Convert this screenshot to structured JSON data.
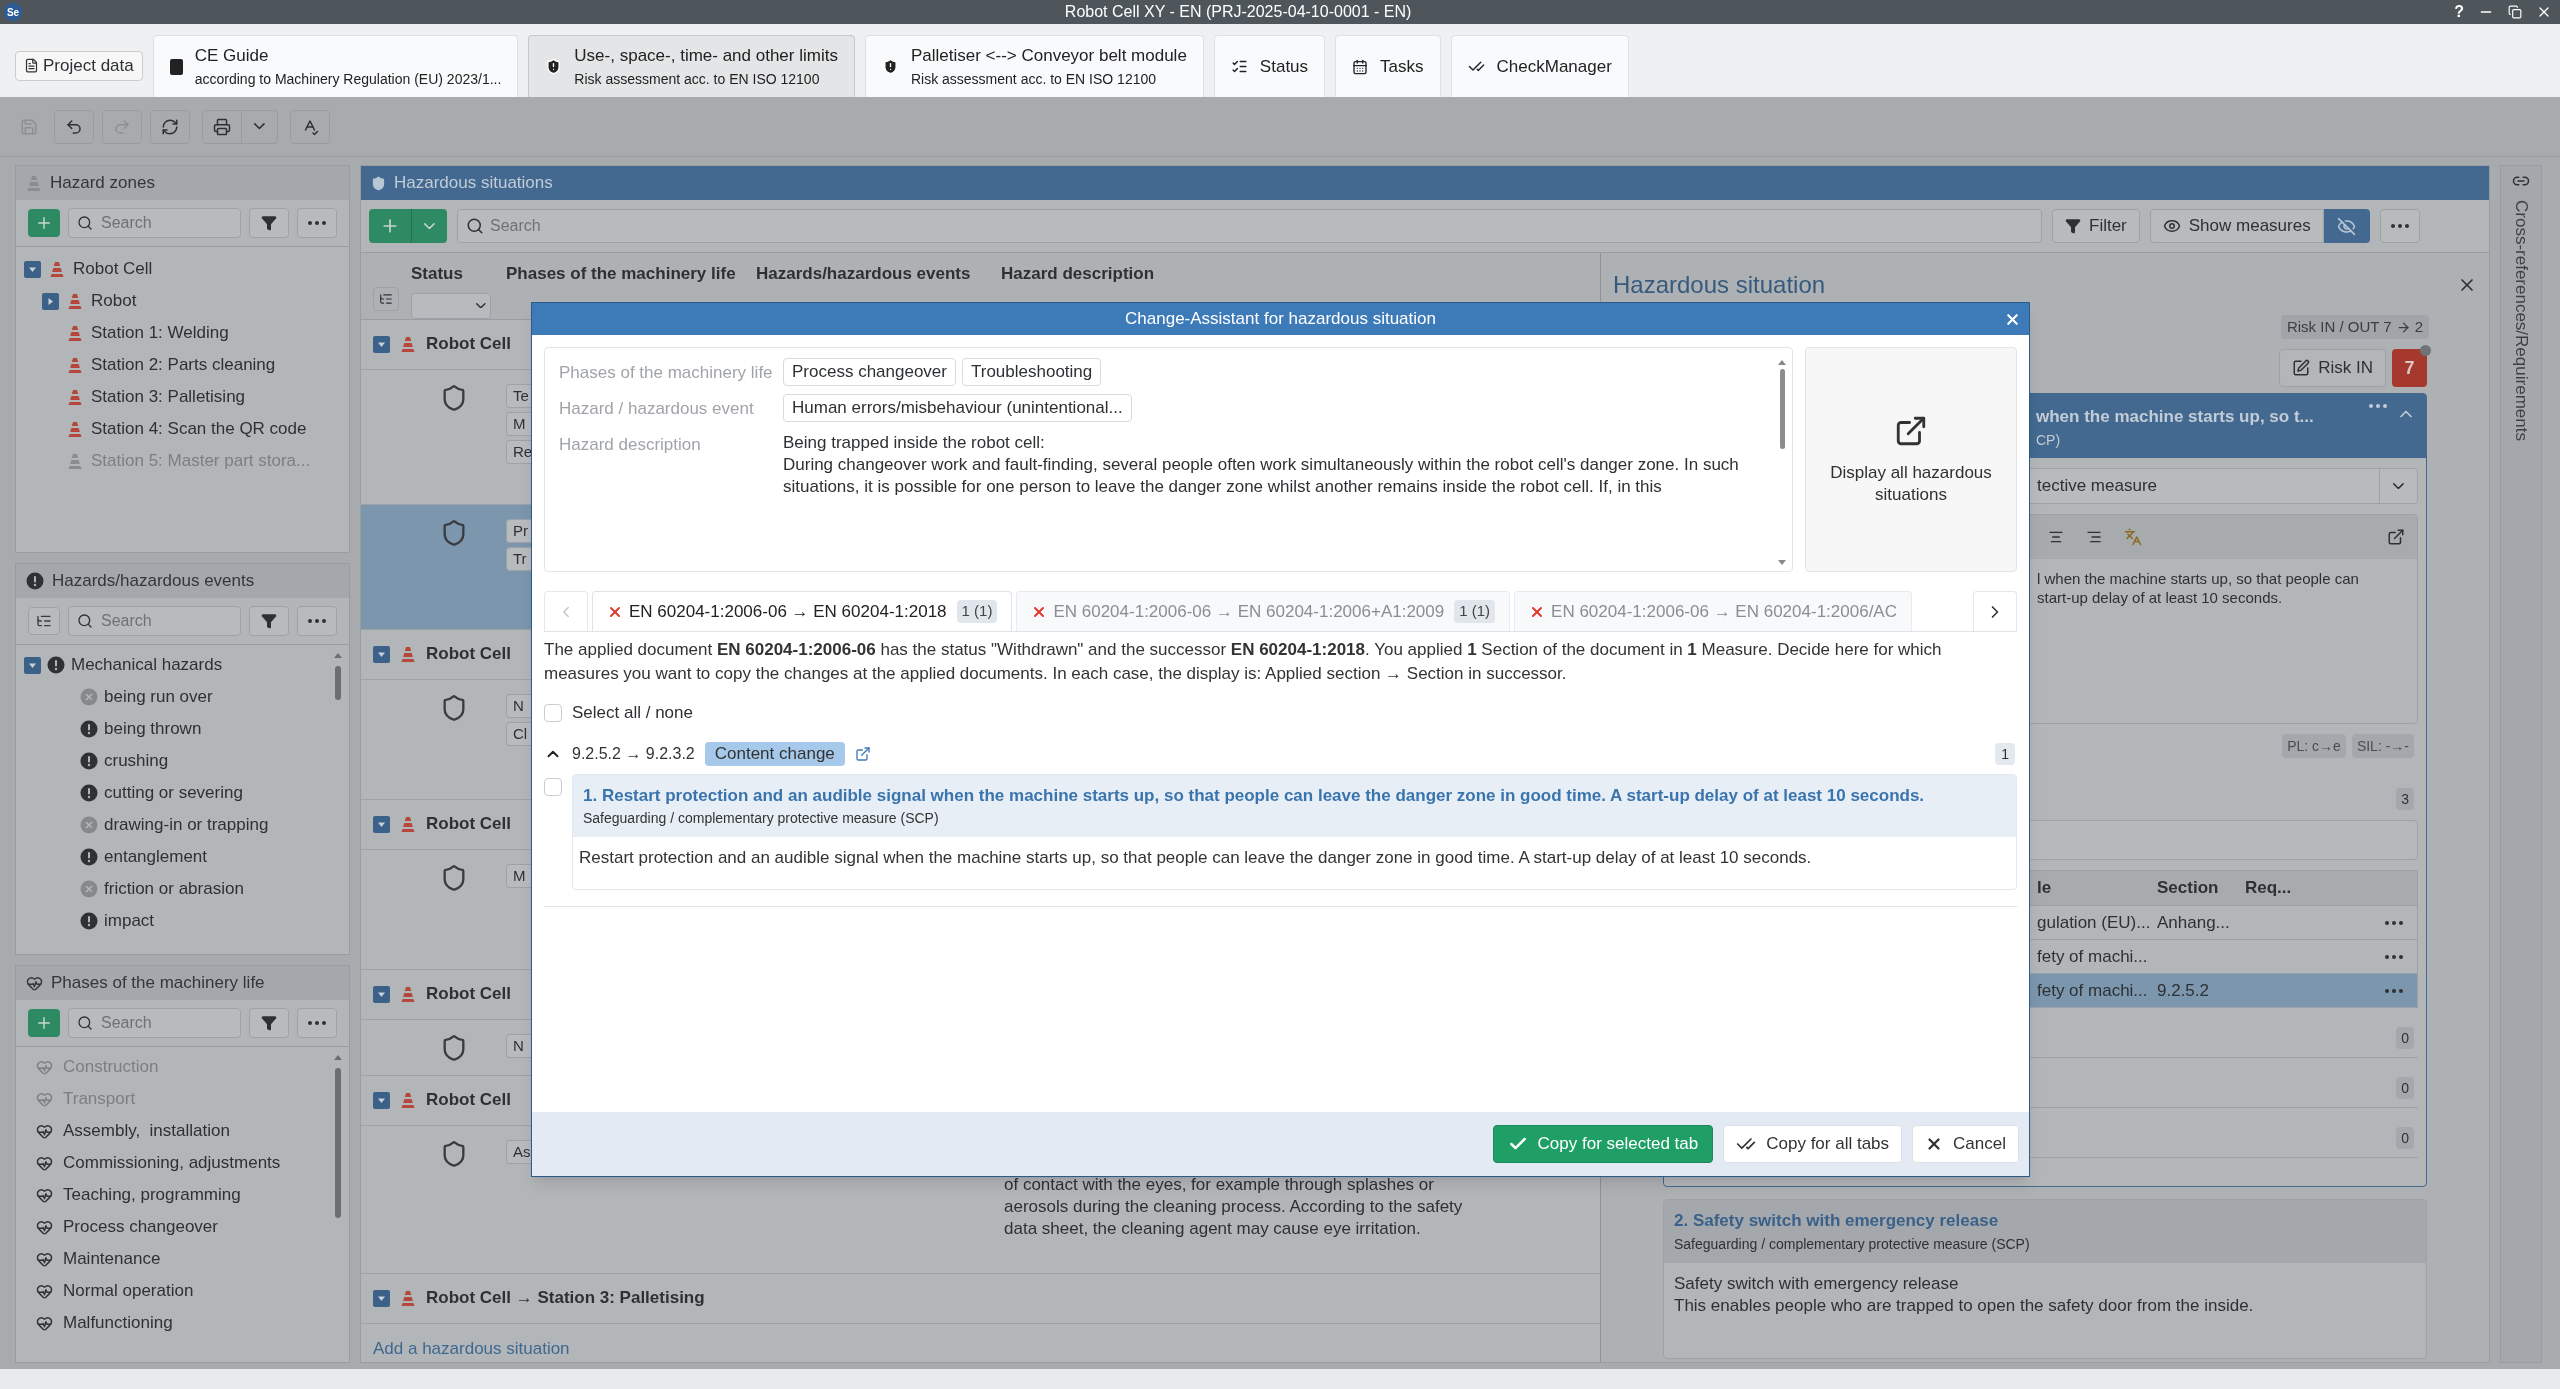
{
  "app": {
    "logo": "Se",
    "title": "Robot Cell XY - EN (PRJ-2025-04-10-0001 - EN)",
    "help": "?"
  },
  "document_tabs": [
    {
      "kind": "project",
      "title": "Project data",
      "selected": false
    },
    {
      "kind": "guide",
      "title": "CE Guide",
      "subtitle": "according to Machinery Regulation (EU) 2023/1...",
      "selected": false
    },
    {
      "kind": "risk",
      "title": "Use-, space-, time- and other limits",
      "subtitle": "Risk assessment acc. to EN ISO 12100",
      "selected": true
    },
    {
      "kind": "risk",
      "title": "Palletiser <--> Conveyor belt module",
      "subtitle": "Risk assessment acc. to EN ISO 12100",
      "selected": false
    },
    {
      "kind": "status",
      "title": "Status",
      "selected": false
    },
    {
      "kind": "tasks",
      "title": "Tasks",
      "selected": false
    },
    {
      "kind": "check",
      "title": "CheckManager",
      "selected": false
    }
  ],
  "hazard_zones": {
    "title": "Hazard zones",
    "search_placeholder": "Search",
    "tree": [
      {
        "label": "Robot Cell",
        "disabled": false,
        "expanded": true,
        "children": [
          {
            "label": "Robot",
            "disabled": false,
            "expanded": false
          },
          {
            "label": "Station 1: Welding",
            "disabled": false
          },
          {
            "label": "Station 2: Parts cleaning",
            "disabled": false
          },
          {
            "label": "Station 3: Palletising",
            "disabled": false
          },
          {
            "label": "Station 4: Scan the QR code",
            "disabled": false
          },
          {
            "label": "Station 5: Master part stora...",
            "disabled": true
          }
        ]
      }
    ]
  },
  "hazards": {
    "title": "Hazards/hazardous events",
    "search_placeholder": "Search",
    "tree": [
      {
        "label": "Mechanical hazards",
        "applicable": true,
        "expanded": true,
        "children": [
          {
            "label": "being run over",
            "applicable": false
          },
          {
            "label": "being thrown",
            "applicable": true
          },
          {
            "label": "crushing",
            "applicable": true
          },
          {
            "label": "cutting or severing",
            "applicable": true
          },
          {
            "label": "drawing-in or trapping",
            "applicable": false
          },
          {
            "label": "entanglement",
            "applicable": true
          },
          {
            "label": "friction or abrasion",
            "applicable": false
          },
          {
            "label": "impact",
            "applicable": true
          }
        ]
      }
    ]
  },
  "phases": {
    "title": "Phases of the machinery life",
    "search_placeholder": "Search",
    "items": [
      {
        "label": "Construction",
        "disabled": true
      },
      {
        "label": "Transport",
        "disabled": true
      },
      {
        "label": "Assembly,  installation",
        "disabled": false
      },
      {
        "label": "Commissioning, adjustments",
        "disabled": false
      },
      {
        "label": "Teaching, programming",
        "disabled": false
      },
      {
        "label": "Process changeover",
        "disabled": false
      },
      {
        "label": "Maintenance",
        "disabled": false
      },
      {
        "label": "Normal operation",
        "disabled": false
      },
      {
        "label": "Malfunctioning",
        "disabled": false
      }
    ]
  },
  "hazardous_situations": {
    "title": "Hazardous situations",
    "search_placeholder": "Search",
    "filter": "Filter",
    "show_measures": "Show measures",
    "hide_measures_on": true,
    "columns": [
      "Status",
      "Phases of the machinery life",
      "Hazards/hazardous events",
      "Hazard description"
    ],
    "groups": [
      {
        "title": "Robot Cell",
        "expanded": true,
        "rows": [
          {
            "selected": false,
            "chips": [
              "Te",
              "M",
              "Re"
            ]
          },
          {
            "selected": true,
            "chips": [
              "Pr",
              "Tr"
            ]
          }
        ]
      },
      {
        "title": "Robot Cell",
        "expanded": true,
        "rows": [
          {
            "selected": false,
            "chips": [
              "N",
              "Cl"
            ]
          }
        ]
      },
      {
        "title": "Robot Cell",
        "expanded": true,
        "rows": [
          {
            "selected": false,
            "chips": [
              "M"
            ]
          }
        ]
      },
      {
        "title": "Robot Cell",
        "expanded": true,
        "rows": [
          {
            "selected": false,
            "chips": [
              "N"
            ]
          }
        ]
      },
      {
        "title": "Robot Cell",
        "expanded": true,
        "rows": [
          {
            "selected": false,
            "chips": [
              "As"
            ],
            "description": [
              "of contact with the eyes, for example through splashes or",
              "aerosols during the cleaning process. According to the safety",
              "data sheet, the cleaning agent may cause eye irritation."
            ]
          }
        ]
      },
      {
        "title": "Robot Cell → Station 3: Palletising",
        "expanded": true
      }
    ],
    "add_link": "Add a hazardous situation"
  },
  "detail": {
    "title": "Hazardous situation",
    "risk_summary": "Risk IN / OUT 7",
    "risk_out": "2",
    "risk_in_button": "Risk IN",
    "risk_value": "7",
    "measure": {
      "title": "when the machine starts up, so t...",
      "subtitle": "CP)",
      "type": "tective measure",
      "text": [
        "l when the machine starts up, so that people can",
        "start-up delay of at least 10 seconds."
      ],
      "pl": "PL: c→e",
      "sil": "SIL: -→-",
      "count": "3",
      "table": {
        "columns": [
          "le",
          "Section",
          "Req..."
        ],
        "rows": [
          {
            "title": "gulation (EU)...",
            "section": "Anhang...",
            "selected": false
          },
          {
            "title": "fety of machi...",
            "selected": false
          },
          {
            "title": "fety of machi...",
            "section": "9.2.5.2",
            "selected": true
          }
        ]
      },
      "counts": [
        "0",
        "0",
        "0"
      ]
    },
    "measure2": {
      "title": "2. Safety switch with emergency release",
      "subtitle": "Safeguarding / complementary protective measure (SCP)",
      "text": [
        "Safety switch with emergency release",
        "This enables people who are trapped to open the safety door from the inside."
      ]
    }
  },
  "side_strip": "Cross-references/Requirements",
  "dialog": {
    "title": "Change-Assistant for hazardous situation",
    "info": [
      {
        "label": "Phases of the machinery life",
        "chips": [
          "Process changeover",
          "Troubleshooting"
        ]
      },
      {
        "label": "Hazard / hazardous event",
        "chips": [
          "Human errors/misbehaviour (unintentional..."
        ]
      },
      {
        "label": "Hazard description",
        "text": [
          "Being trapped inside the robot cell:",
          "During changeover work and fault-finding, several people often work simultaneously within the robot cell's danger zone. In such situations, it is possible for one person to leave the danger zone whilst another remains inside the robot cell. If, in this"
        ]
      }
    ],
    "display_all": "Display all hazardous situations",
    "tabs": [
      {
        "label": "EN 60204-1:2006-06 → EN 60204-1:2018",
        "count": "1 (1)",
        "selected": true
      },
      {
        "label": "EN 60204-1:2006-06 → EN 60204-1:2006+A1:2009",
        "count": "1 (1)",
        "selected": false
      },
      {
        "label": "EN 60204-1:2006-06 → EN 60204-1:2006/AC",
        "selected": false
      }
    ],
    "explanation": "The applied document **EN 60204-1:2006-06** has the status \"Withdrawn\" and the successor **EN 60204-1:2018**. You applied **1** Section of the document in **1** Measure. Decide here for which measures you want to copy the changes at the applied documents. In each case, the display is: Applied section → Section in successor.",
    "select_all": {
      "label": "Select all / none",
      "checked": false
    },
    "section": {
      "label": "9.2.5.2 → 9.2.3.2",
      "expanded": true,
      "badge": "Content change",
      "count": "1",
      "measures": [
        {
          "checked": false,
          "title": "1. Restart protection and an audible signal when the machine starts up, so that people can leave the danger zone in good time. A start-up delay of at least 10 seconds.",
          "subtitle": "Safeguarding / complementary protective measure (SCP)",
          "text": "Restart protection and an audible signal when the machine starts up, so that people can leave the danger zone in good time. A start-up delay of at least 10 seconds."
        }
      ]
    },
    "buttons": [
      {
        "kind": "primary",
        "label": "Copy for selected tab"
      },
      {
        "kind": "all",
        "label": "Copy for all tabs"
      },
      {
        "kind": "cancel",
        "label": "Cancel"
      }
    ]
  }
}
